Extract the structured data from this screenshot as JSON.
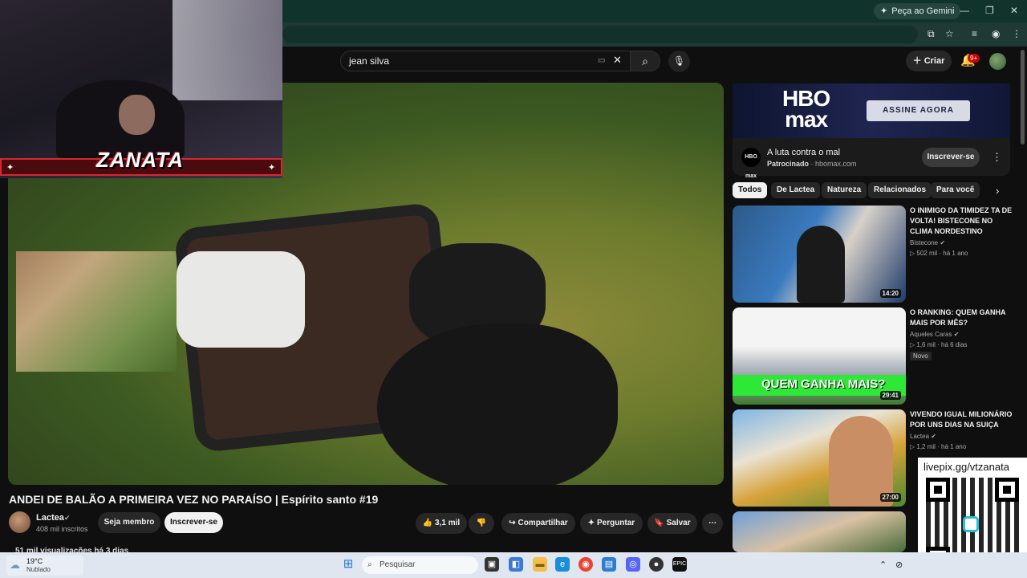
{
  "browser": {
    "gemini_label": "Peça ao Gemini",
    "window_controls": {
      "minimize": "—",
      "maximize": "❐",
      "close": "✕"
    }
  },
  "header": {
    "search_value": "jean silva",
    "criar_label": "Criar",
    "notifications_badge": "9+"
  },
  "overlay": {
    "streamer_name": "ZANATA",
    "qr_url": "livepix.gg/vtzanata"
  },
  "video": {
    "title": "ANDEI DE BALÃO A PRIMEIRA VEZ NO PARAÍSO | Espírito santo #19",
    "channel": "Lactea",
    "subscribers": "408 mil inscritos",
    "member_label": "Seja membro",
    "subscribe_label": "Inscrever-se",
    "likes": "3,1 mil",
    "share_label": "Compartilhar",
    "ask_label": "Perguntar",
    "save_label": "Salvar",
    "views_line": "51 mil visualizações há 3 dias"
  },
  "ad": {
    "brand_line1": "HBO",
    "brand_line2": "max",
    "cta_banner": "ASSINE AGORA",
    "logo_text": "HBO max",
    "title": "A luta contra o mal",
    "sponsored_label": "Patrocinado",
    "domain": "hbomax.com",
    "subscribe_label": "Inscrever-se"
  },
  "chips": [
    "Todos",
    "De Lactea",
    "Natureza",
    "Relacionados",
    "Para você"
  ],
  "recommendations": [
    {
      "title": "O INIMIGO DA TIMIDEZ TA DE VOLTA! BISTECONE NO CLIMA NORDESTINO",
      "channel": "Bistecone",
      "views": "502 mil",
      "age": "há 1 ano",
      "duration": "14:20",
      "badge": ""
    },
    {
      "title": "O RANKING: QUEM GANHA MAIS POR MÊS?",
      "channel": "Aqueles Caras",
      "views": "1,6 mil",
      "age": "há 6 dias",
      "duration": "29:41",
      "badge": "Novo",
      "thumb_caption": "QUEM GANHA MAIS?"
    },
    {
      "title": "VIVENDO IGUAL MILIONÁRIO POR UNS DIAS NA SUIÇA",
      "channel": "Lactea",
      "views": "1,2 mil",
      "age": "há 1 ano",
      "duration": "27:00",
      "badge": ""
    }
  ],
  "taskbar": {
    "temperature": "19°C",
    "weather": "Nublado",
    "search_placeholder": "Pesquisar"
  },
  "colors": {
    "browser_bar": "#10332c",
    "yt_bg": "#0f0f0f",
    "badge_red": "#cc0000",
    "qr_caption_green": "#1eff3a"
  }
}
